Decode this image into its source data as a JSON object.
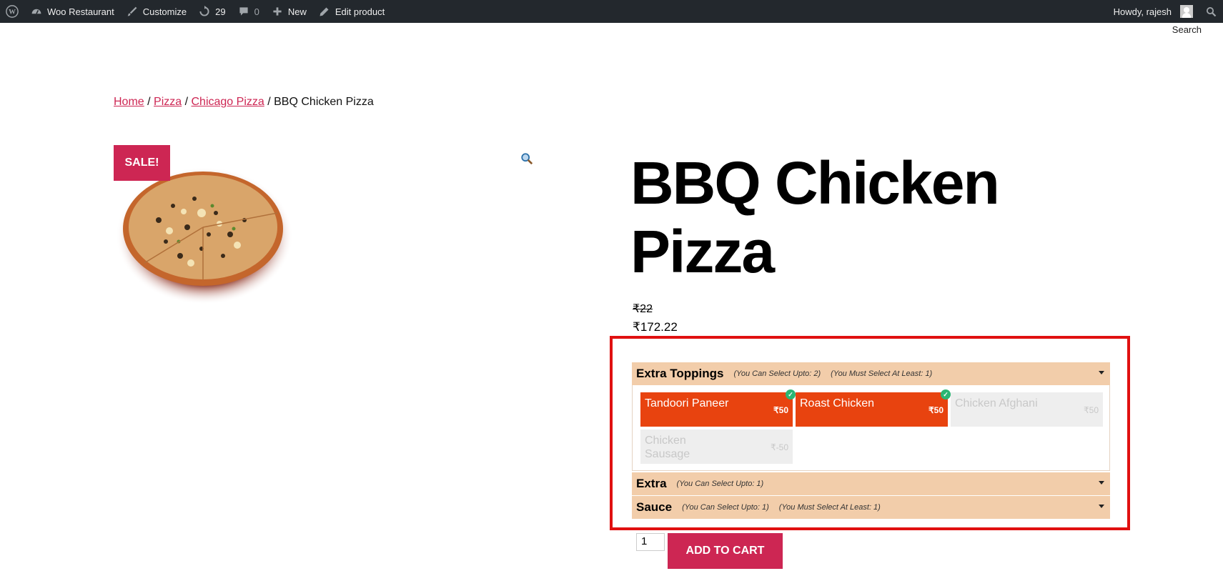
{
  "adminbar": {
    "site_name": "Woo Restaurant",
    "customize": "Customize",
    "updates_count": "29",
    "comments_count": "0",
    "new_label": "New",
    "edit_label": "Edit product",
    "howdy": "Howdy, rajesh",
    "icons": [
      "wordpress-logo-icon",
      "dashboard-icon",
      "brush-icon",
      "updates-icon",
      "comment-icon",
      "plus-icon",
      "pencil-icon",
      "user-avatar-icon",
      "search-icon"
    ]
  },
  "search_link": "Search",
  "breadcrumb": {
    "home": "Home",
    "pizza": "Pizza",
    "category": "Chicago Pizza",
    "current": "BBQ Chicken Pizza",
    "sep": " / "
  },
  "product": {
    "sale_badge": "SALE!",
    "title": "BBQ Chicken Pizza",
    "old_price": "₹22",
    "new_price": "₹172.22"
  },
  "addons": {
    "groups": [
      {
        "name": "Extra Toppings",
        "note_max": "(You Can Select Upto: 2)",
        "note_min": "(You Must Select At Least: 1)",
        "options": [
          {
            "name": "Tandoori Paneer",
            "price": "₹50",
            "selected": true
          },
          {
            "name": "Roast Chicken",
            "price": "₹50",
            "selected": true
          },
          {
            "name": "Chicken Afghani",
            "price": "₹50",
            "selected": false
          },
          {
            "name": "Chicken Sausage",
            "price": "₹-50",
            "selected": false
          }
        ]
      },
      {
        "name": "Extra",
        "note_max": "(You Can Select Upto: 1)"
      },
      {
        "name": "Sauce",
        "note_max": "(You Can Select Upto: 1)",
        "note_min": "(You Must Select At Least: 1)"
      }
    ]
  },
  "cart": {
    "quantity": "1",
    "add_label": "ADD TO CART"
  },
  "colors": {
    "accent": "#cd2653",
    "selected_option": "#e8430f",
    "group_header": "#f2cdaa",
    "highlight_border": "#e01010",
    "check": "#2bb673"
  }
}
